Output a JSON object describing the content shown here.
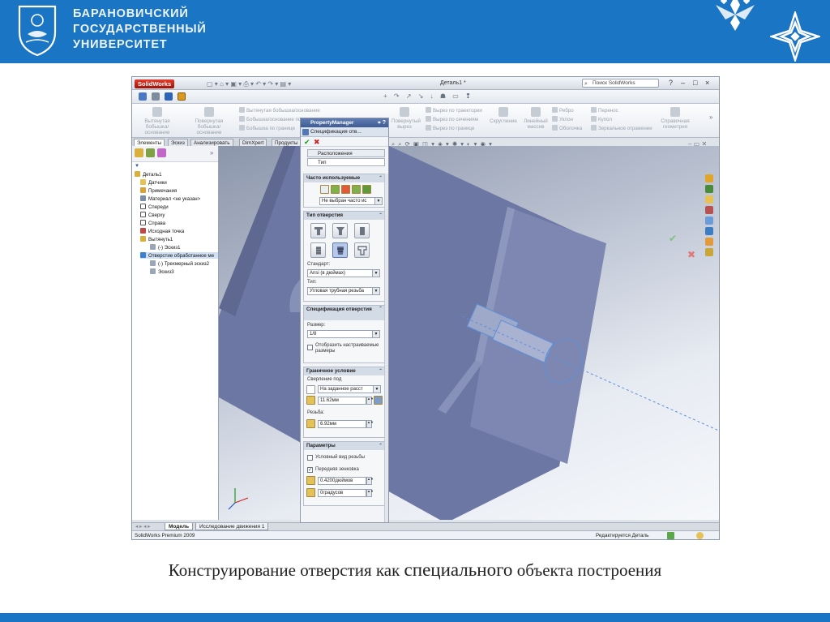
{
  "header": {
    "university_lines": [
      "БАРАНОВИЧСКИЙ",
      "ГОСУДАРСТВЕННЫЙ",
      "УНИВЕРСИТЕТ"
    ]
  },
  "solidworks": {
    "app_logo": "SolidWorks",
    "document_title": "Деталь1 *",
    "search_placeholder": "Поиск SolidWorks",
    "window_controls": [
      "?",
      "–",
      "□",
      "×"
    ],
    "command_manager": {
      "large_buttons": [
        "Вытянутая бобышка/основание",
        "Повернутая бобышка/основание",
        "Повернутый вырез",
        "Скругление",
        "Линейный массив",
        "Справочная геометрия"
      ],
      "small_buttons": [
        "Вытянутая бобышка/основание",
        "Бобышка/основание по сечениям",
        "Бобышка по границе",
        "Вырез по траектории",
        "Вырез по сечениям",
        "Вырез по границе",
        "Ребро",
        "Уклон",
        "Оболочка",
        "Перенос",
        "Купол",
        "Зеркальное отражение"
      ]
    },
    "tabs": [
      "Элементы",
      "Эскиз",
      "Анализировать",
      "DimXpert",
      "Продукты"
    ],
    "tree": {
      "items": [
        "Деталь1",
        "Датчики",
        "Примечания",
        "Материал <не указан>",
        "Спереди",
        "Сверху",
        "Справа",
        "Исходная точка",
        "Вытянуть1",
        "(-) Эскиз1",
        "Отверстие обработанное ме",
        "(-) Трехмерный эскиз2",
        "Эскиз3"
      ]
    },
    "property_manager": {
      "header": "PropertyManager",
      "feature_title": "Спецификация отв...",
      "ok_symbol": "✔",
      "cancel_symbol": "✖",
      "tabs": [
        "Расположения",
        "Тип"
      ],
      "favorites": {
        "title": "Часто используемые",
        "value": "Не выбран часто ис"
      },
      "hole_type": {
        "title": "Тип отверстия",
        "standard_label": "Стандарт:",
        "standard_value": "Ansi (в дюймах)",
        "type_label": "Тип:",
        "type_value": "Угловая трубная резьба"
      },
      "hole_spec": {
        "title": "Спецификация отверстия",
        "size_label": "Размер:",
        "size_value": "1/8",
        "custom_checkbox": "Отобразить настраиваемые размеры"
      },
      "end_condition": {
        "title": "Граничное условие",
        "drill_label": "Сверление под",
        "drill_value": "На заданное расст",
        "depth_value": "11.62мм",
        "thread_label": "Резьба:",
        "thread_value": "6.92мм"
      },
      "options": {
        "title": "Параметры",
        "cosmetic": "Условный вид резьбы",
        "countersink": "Передняя зенковка",
        "dia_value": "0.4200дюймов",
        "angle_value": "0градусов"
      }
    },
    "bottom_tabs": [
      "Модель",
      "Исследование движения 1"
    ],
    "status": {
      "left": "SolidWorks Premium 2009",
      "right": "Редактируется Деталь"
    }
  },
  "caption": {
    "before": "Конструирование отверстия как ",
    "emphasis": "специального",
    "after": " объекта построения"
  }
}
